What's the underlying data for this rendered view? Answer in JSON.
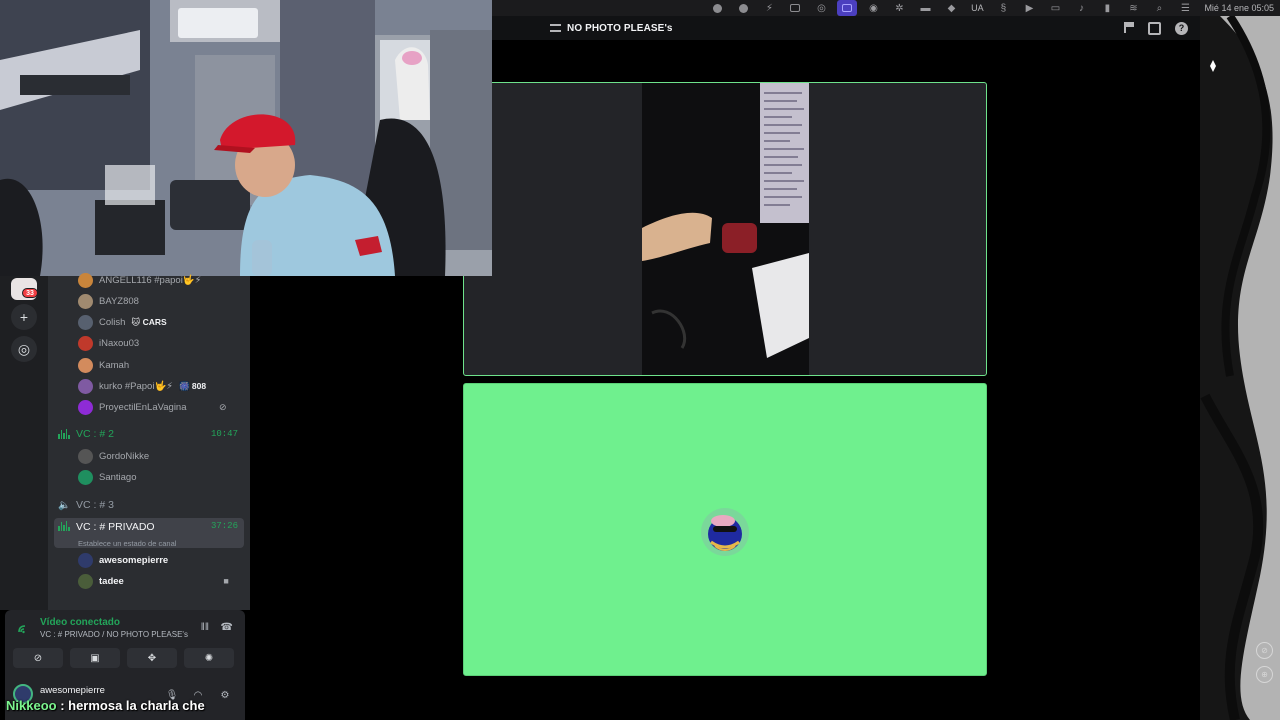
{
  "menubar": {
    "lang": "UA",
    "clock": "Mié 14 ene  05:05"
  },
  "window": {
    "title": "NO PHOTO PLEASE's"
  },
  "rail": {
    "badge": "33",
    "add_icon": "plus-icon",
    "discover_icon": "compass-icon"
  },
  "channels": {
    "vc1_members": [
      {
        "name": "ANGELL116 #papoi🤟⚡",
        "color": "#c9853b"
      },
      {
        "name": "BAYZ808",
        "color": "#a08a70"
      },
      {
        "name": "Colish",
        "tag": "🐱 CARS",
        "color": "#57606f"
      },
      {
        "name": "iNaxou03",
        "color": "#c0392b"
      },
      {
        "name": "Kamah",
        "color": "#d38b5d"
      },
      {
        "name": "kurko #Papoi🤟⚡",
        "tag": "🎆 808",
        "color": "#7f5aa2"
      },
      {
        "name": "ProyectilEnLaVagina",
        "color": "#8e2bd6"
      }
    ],
    "vc2": {
      "name": "VC : # 2",
      "time": "10:47"
    },
    "vc2_members": [
      {
        "name": "GordoNikke",
        "color": "#555"
      },
      {
        "name": "Santiago",
        "color": "#1f8f5f"
      }
    ],
    "vc3": {
      "name": "VC : # 3"
    },
    "vc_private": {
      "name": "VC : # PRIVADO",
      "time": "37:26",
      "status": "Establece un estado de canal"
    },
    "private_members": [
      {
        "name": "awesomepierre",
        "color": "#2f3b6b"
      },
      {
        "name": "tadee",
        "color": "#4a5d3a"
      }
    ]
  },
  "voice_panel": {
    "status": "Vídeo conectado",
    "subtitle": "VC : # PRIVADO / NO PHOTO PLEASE's"
  },
  "user": {
    "name": "awesomepierre"
  },
  "chat": {
    "user": "Nikkeoo",
    "message": " : hermosa la charla che"
  },
  "colors": {
    "online_green": "#23a55a",
    "tile_green": "#6ff08e",
    "badge_red": "#f23f43"
  }
}
